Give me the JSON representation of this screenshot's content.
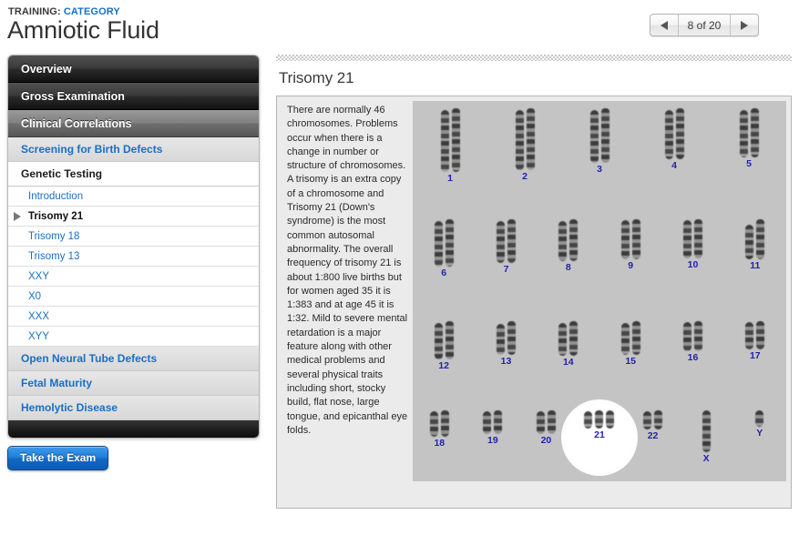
{
  "header": {
    "breadcrumb_label": "TRAINING:",
    "breadcrumb_category": "CATEGORY",
    "page_title": "Amniotic Fluid"
  },
  "pagination": {
    "prev_icon": "triangle-left-icon",
    "next_icon": "triangle-right-icon",
    "label": "8 of 20",
    "current": 8,
    "total": 20
  },
  "sidebar": {
    "top_items": [
      {
        "label": "Overview",
        "active": false
      },
      {
        "label": "Gross Examination",
        "active": false
      },
      {
        "label": "Clinical Correlations",
        "active": true
      }
    ],
    "sections": [
      {
        "label": "Screening for Birth Defects",
        "style": "shaded"
      },
      {
        "label": "Genetic Testing",
        "style": "plain"
      }
    ],
    "sub_items": [
      {
        "label": "Introduction",
        "current": false
      },
      {
        "label": "Trisomy 21",
        "current": true
      },
      {
        "label": "Trisomy 18",
        "current": false
      },
      {
        "label": "Trisomy 13",
        "current": false
      },
      {
        "label": "XXY",
        "current": false
      },
      {
        "label": "X0",
        "current": false
      },
      {
        "label": "XXX",
        "current": false
      },
      {
        "label": "XYY",
        "current": false
      }
    ],
    "bottom_sections": [
      {
        "label": "Open Neural Tube Defects"
      },
      {
        "label": "Fetal Maturity"
      },
      {
        "label": "Hemolytic Disease"
      }
    ],
    "marker_icon": "triangle-right-pointer-icon"
  },
  "exam_button": {
    "label": "Take the Exam"
  },
  "main": {
    "content_title": "Trisomy 21",
    "body_text": "There are normally 46 chromosomes. Problems occur when there is a change in number or structure of chromosomes. A trisomy is an extra copy of a chromosome and Trisomy 21 (Down's syndrome) is the most common autosomal abnormality. The overall frequency of trisomy 21 is about 1:800 live births but for women aged 35 it is 1:383 and at age 45 it is 1:32. Mild to severe mental retardation is a major feature along with other medical problems and several physical traits including short, stocky build, flat nose, large tongue, and epicanthal eye folds."
  },
  "karyotype": {
    "image_name": "trisomy-21-karyotype-image",
    "highlight_label": "21",
    "rows": [
      {
        "groups": [
          {
            "label": "1",
            "count": 2,
            "heights": [
              68,
              70
            ]
          },
          {
            "label": "2",
            "count": 2,
            "heights": [
              66,
              68
            ]
          },
          {
            "label": "3",
            "count": 2,
            "heights": [
              58,
              60
            ]
          },
          {
            "label": "4",
            "count": 2,
            "heights": [
              54,
              56
            ]
          },
          {
            "label": "5",
            "count": 2,
            "heights": [
              52,
              54
            ]
          }
        ]
      },
      {
        "groups": [
          {
            "label": "6",
            "count": 2,
            "heights": [
              50,
              52
            ]
          },
          {
            "label": "7",
            "count": 2,
            "heights": [
              46,
              48
            ]
          },
          {
            "label": "8",
            "count": 2,
            "heights": [
              44,
              46
            ]
          },
          {
            "label": "9",
            "count": 2,
            "heights": [
              43,
              44
            ]
          },
          {
            "label": "10",
            "count": 2,
            "heights": [
              42,
              43
            ]
          },
          {
            "label": "11",
            "count": 2,
            "heights": [
              38,
              44
            ]
          }
        ]
      },
      {
        "groups": [
          {
            "label": "12",
            "count": 2,
            "heights": [
              40,
              42
            ]
          },
          {
            "label": "13",
            "count": 2,
            "heights": [
              34,
              37
            ]
          },
          {
            "label": "14",
            "count": 2,
            "heights": [
              36,
              38
            ]
          },
          {
            "label": "15",
            "count": 2,
            "heights": [
              35,
              37
            ]
          },
          {
            "label": "16",
            "count": 2,
            "heights": [
              32,
              33
            ]
          },
          {
            "label": "17",
            "count": 2,
            "heights": [
              30,
              31
            ]
          }
        ]
      },
      {
        "groups": [
          {
            "label": "18",
            "count": 2,
            "heights": [
              28,
              29
            ]
          },
          {
            "label": "19",
            "count": 2,
            "heights": [
              25,
              26
            ]
          },
          {
            "label": "20",
            "count": 2,
            "heights": [
              25,
              26
            ]
          },
          {
            "label": "21",
            "count": 3,
            "heights": [
              19,
              20,
              20
            ]
          },
          {
            "label": "22",
            "count": 2,
            "heights": [
              20,
              21
            ]
          },
          {
            "label": "X",
            "count": 1,
            "heights": [
              46
            ]
          },
          {
            "label": "Y",
            "count": 1,
            "heights": [
              18
            ]
          }
        ]
      }
    ]
  }
}
